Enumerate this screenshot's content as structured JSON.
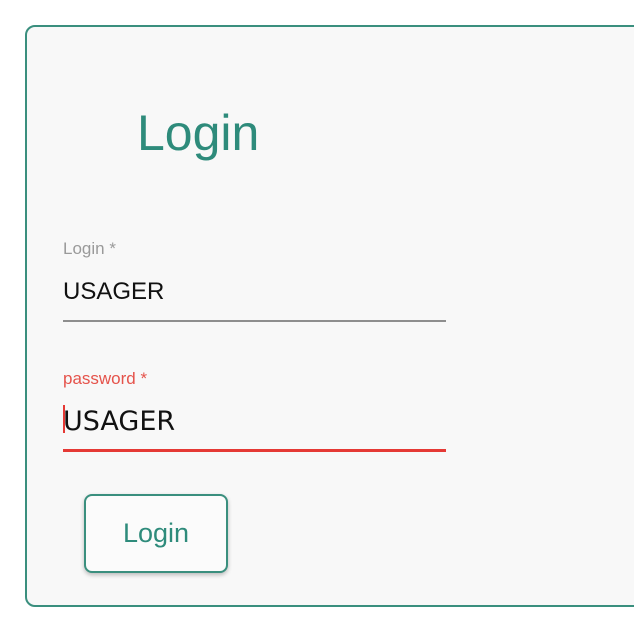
{
  "form": {
    "title": "Login",
    "login_field": {
      "label": "Login *",
      "value": "USAGER"
    },
    "password_field": {
      "label": "password *",
      "value": "USAGER"
    },
    "submit_label": "Login"
  },
  "colors": {
    "accent": "#2e8b7b",
    "border": "#3a8f7e",
    "error": "#e53935",
    "muted_label": "#9a9a9a",
    "card_background": "#f8f8f8"
  }
}
